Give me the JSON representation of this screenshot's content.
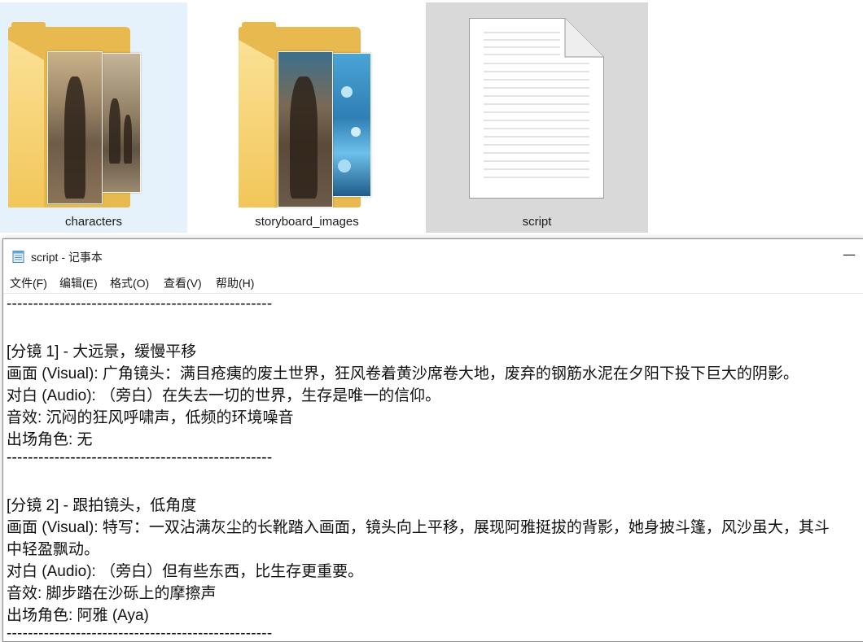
{
  "explorer": {
    "items": [
      {
        "name": "characters",
        "type": "folder",
        "state": "selected"
      },
      {
        "name": "storyboard_images",
        "type": "folder",
        "state": "normal"
      },
      {
        "name": "script",
        "type": "text-file",
        "state": "hover"
      }
    ]
  },
  "notepad": {
    "title": "script - 记事本",
    "minimize_glyph": "—",
    "menu": [
      "文件(F)",
      "编辑(E)",
      "格式(O)",
      "查看(V)",
      "帮助(H)"
    ],
    "lines": [
      "--------------------------------------------------",
      "",
      "[分镜 1] - 大远景，缓慢平移",
      "画面 (Visual): 广角镜头：满目疮痍的废土世界，狂风卷着黄沙席卷大地，废弃的钢筋水泥在夕阳下投下巨大的阴影。",
      "对白 (Audio): （旁白）在失去一切的世界，生存是唯一的信仰。",
      "音效: 沉闷的狂风呼啸声，低频的环境噪音",
      "出场角色: 无",
      "--------------------------------------------------",
      "",
      "[分镜 2] - 跟拍镜头，低角度",
      "画面 (Visual): 特写：一双沾满灰尘的长靴踏入画面，镜头向上平移，展现阿雅挺拔的背影，她身披斗篷，风沙虽大，其斗",
      "中轻盈飘动。",
      "对白 (Audio): （旁白）但有些东西，比生存更重要。",
      "音效: 脚步踏在沙砾上的摩擦声",
      "出场角色: 阿雅 (Aya)",
      "--------------------------------------------------"
    ]
  },
  "colors": {
    "selected_tile": "#e5f1fb",
    "hover_tile": "#d9d9d9",
    "folder": "#e7b94e"
  }
}
